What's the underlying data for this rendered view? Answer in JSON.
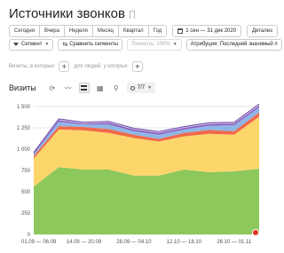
{
  "header": {
    "title": "Источники звонков"
  },
  "period": {
    "options": [
      "Сегодня",
      "Вчера",
      "Неделя",
      "Месяц",
      "Квартал",
      "Год"
    ],
    "date_range": "1 сен — 31 дек 2020",
    "detail_label": "Детализ"
  },
  "controls": {
    "segment_label": "Сегмент",
    "compare_label": "Сравнить сегменты",
    "accuracy_label": "Точность: 100%",
    "attribution_label": "Атрибуция: Последний значимый п"
  },
  "filters": {
    "visits_label": "Визиты, в которых",
    "people_label": "для людей, у которых"
  },
  "chart_section": {
    "title": "Визиты",
    "metrics_label": "7/7"
  },
  "chart_data": {
    "type": "area",
    "stacked": true,
    "categories": [
      "01.09 — 06.09",
      "07.09 — 13.09",
      "14.09 — 20.09",
      "21.09 — 27.09",
      "28.09 — 04.10",
      "05.10 — 11.10",
      "12.10 — 18.10",
      "19.10 — 25.10",
      "26.10 — 01.11",
      "02.11 — 08.11"
    ],
    "x_tick_labels": [
      "01.09 — 06.09",
      "14.09 — 20.09",
      "28.09 — 04.10",
      "12.10 — 18.10",
      "26.10 — 01.11"
    ],
    "y_ticks": [
      "0",
      "250",
      "500",
      "750",
      "1 000",
      "1 250",
      "1 500"
    ],
    "ylim": [
      0,
      1500
    ],
    "series": [
      {
        "color": "#8dc85c",
        "values": [
          560,
          790,
          760,
          760,
          690,
          690,
          760,
          730,
          740,
          770
        ]
      },
      {
        "color": "#fdd66b",
        "values": [
          330,
          440,
          460,
          430,
          440,
          400,
          390,
          450,
          430,
          610
        ]
      },
      {
        "color": "#f06a4a",
        "values": [
          30,
          40,
          40,
          45,
          40,
          30,
          40,
          45,
          40,
          50
        ]
      },
      {
        "color": "#8fb6e6",
        "values": [
          20,
          50,
          30,
          55,
          40,
          50,
          40,
          50,
          70,
          60
        ]
      },
      {
        "color": "#8a5fc2",
        "values": [
          10,
          20,
          10,
          20,
          20,
          20,
          20,
          20,
          20,
          20
        ]
      },
      {
        "color": "#c8bfe7",
        "values": [
          10,
          10,
          10,
          10,
          10,
          10,
          10,
          10,
          10,
          10
        ]
      },
      {
        "color": "#f8c8b5",
        "values": [
          0,
          5,
          5,
          5,
          5,
          5,
          5,
          5,
          5,
          10
        ]
      }
    ]
  }
}
